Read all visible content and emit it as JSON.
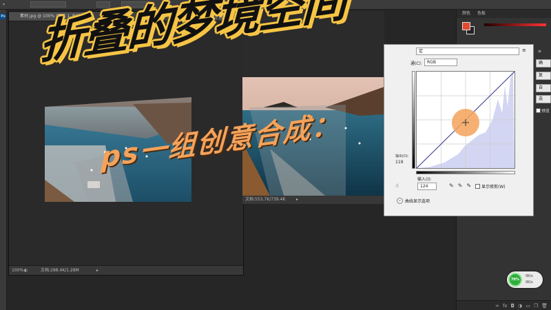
{
  "window": {
    "doc1_tab": "素材.jpg @ 100% (图层 1, RGB/8) *",
    "doc1_zoom": "100%",
    "doc1_status": "文档:288.4K/1.28M",
    "doc2_status": "文档:553.7K/739.4K",
    "min_label": "—",
    "max_label": "□",
    "close_label": "✕",
    "ps_badge": "Ps"
  },
  "overlay": {
    "title": "折叠的梦境空间",
    "subtitle": "ps一组创意合成："
  },
  "curves_dialog": {
    "preset_value": "定",
    "channel_label": "通(C):",
    "channel_value": "RGB",
    "output_label": "输出(O):",
    "output_value": "119",
    "input_label": "输入(I):",
    "input_value": "124",
    "show_clipping": "显示修剪(W)",
    "display_options": "曲线显示选项",
    "side_buttons": [
      "确",
      "复",
      "自",
      "选"
    ],
    "preview_label": "预览",
    "menu_icon": "≡"
  },
  "right_panel": {
    "tab_color": "颜色",
    "tab_swatches": "色板"
  },
  "net_widget": {
    "percent": "70%",
    "up": "0K/s",
    "down": "0K/s"
  },
  "colors": {
    "accent_yellow": "#f6c445",
    "accent_orange": "#f5a25a",
    "fg_swatch": "#e34a2e"
  }
}
